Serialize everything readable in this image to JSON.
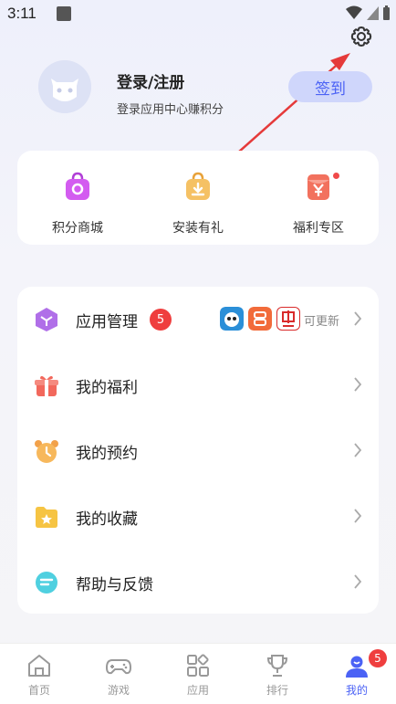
{
  "status_bar": {
    "time": "3:11"
  },
  "profile": {
    "title": "登录/注册",
    "subtitle": "登录应用中心赚积分",
    "sign_in_label": "签到"
  },
  "quick_actions": [
    {
      "label": "积分商城",
      "icon": "shopping-bag-icon"
    },
    {
      "label": "安装有礼",
      "icon": "gift-download-icon"
    },
    {
      "label": "福利专区",
      "icon": "red-envelope-icon"
    }
  ],
  "menu": {
    "app_manage": {
      "label": "应用管理",
      "badge": "5",
      "update_text": "可更新"
    },
    "items": [
      {
        "label": "我的福利",
        "icon": "gift-icon"
      },
      {
        "label": "我的预约",
        "icon": "alarm-clock-icon"
      },
      {
        "label": "我的收藏",
        "icon": "star-folder-icon"
      },
      {
        "label": "帮助与反馈",
        "icon": "chat-bubble-icon"
      }
    ]
  },
  "tabs": [
    {
      "label": "首页",
      "icon": "home-icon"
    },
    {
      "label": "游戏",
      "icon": "gamepad-icon"
    },
    {
      "label": "应用",
      "icon": "apps-grid-icon"
    },
    {
      "label": "排行",
      "icon": "trophy-icon"
    },
    {
      "label": "我的",
      "icon": "user-icon",
      "badge": "5",
      "active": true
    }
  ],
  "colors": {
    "accent": "#4b62f5",
    "badge_red": "#ef3e3e",
    "arrow_red": "#e53a3a"
  }
}
